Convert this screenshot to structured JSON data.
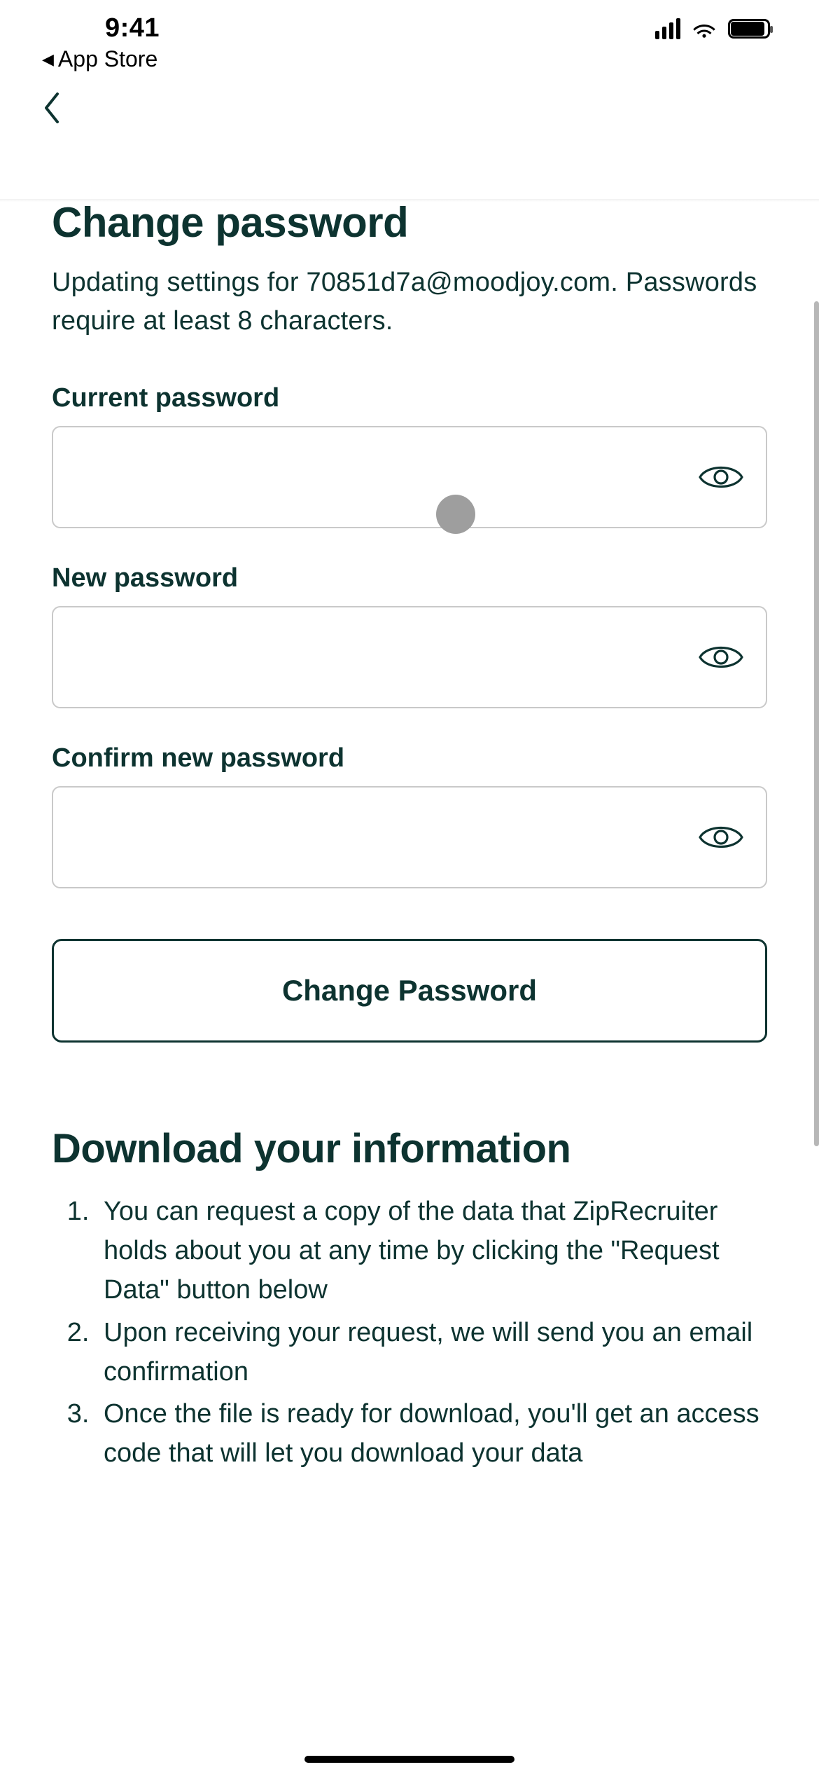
{
  "status": {
    "time": "9:41",
    "app_store": "App Store"
  },
  "page": {
    "title": "Change password",
    "subtitle": "Updating settings for 70851d7a@moodjoy.com. Passwords require at least 8 characters."
  },
  "form": {
    "current_label": "Current password",
    "new_label": "New password",
    "confirm_label": "Confirm new password",
    "submit_label": "Change Password",
    "current_value": "",
    "new_value": "",
    "confirm_value": ""
  },
  "download": {
    "title": "Download your information",
    "steps": [
      "You can request a copy of the data that ZipRecruiter holds about you at any time by clicking the \"Request Data\" button below",
      "Upon receiving your request, we will send you an email confirmation",
      "Once the file is ready for download, you'll get an access code that will let you download your data"
    ]
  }
}
